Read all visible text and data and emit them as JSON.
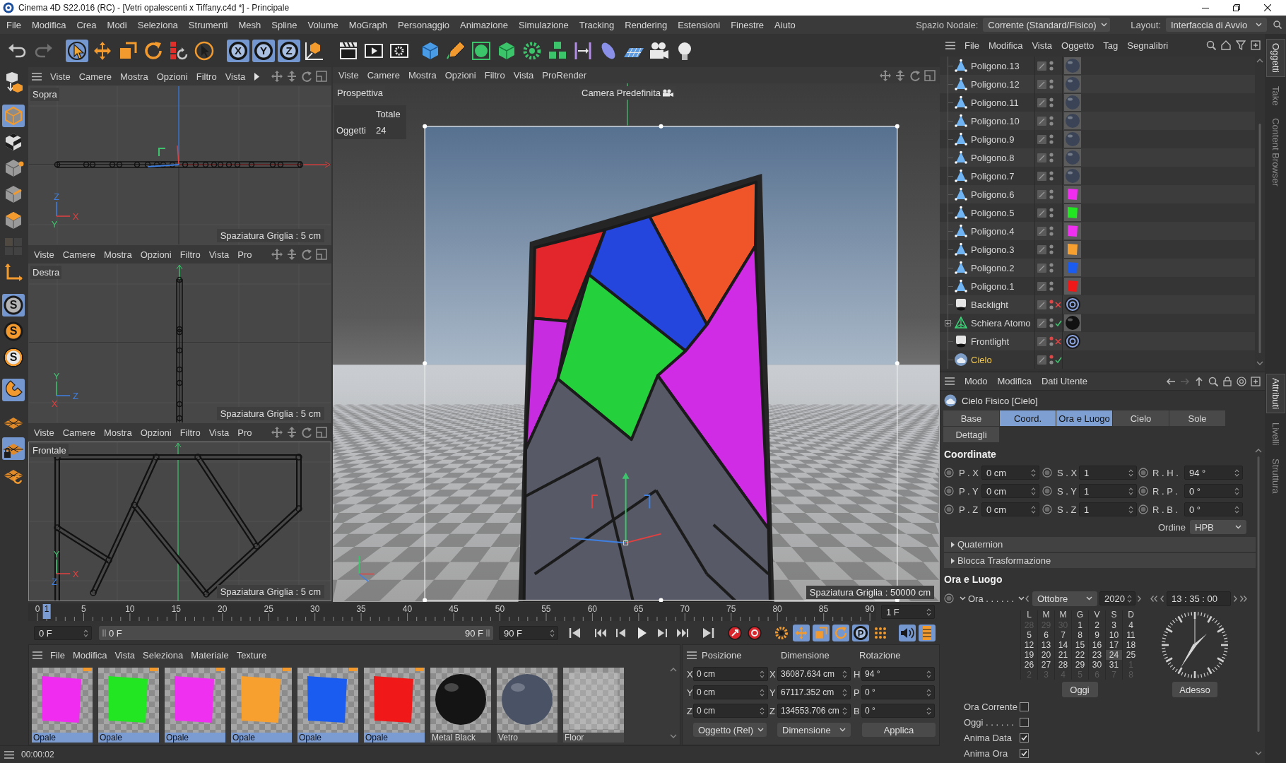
{
  "window": {
    "title": "Cinema 4D S22.016 (RC) - [Vetri opalescenti x Tiffany.c4d *] - Principale"
  },
  "menu_bar": {
    "items": [
      "File",
      "Modifica",
      "Crea",
      "Modi",
      "Seleziona",
      "Strumenti",
      "Mesh",
      "Spline",
      "Volume",
      "MoGraph",
      "Personaggio",
      "Animazione",
      "Simulazione",
      "Tracking",
      "Rendering",
      "Estensioni",
      "Finestre",
      "Aiuto"
    ],
    "node_space": {
      "label": "Spazio Nodale:",
      "value": "Corrente (Standard/Fisico)"
    },
    "layout": {
      "label": "Layout:",
      "value": "Interfaccia di Avvio"
    }
  },
  "toolbar": {
    "tools": [
      {
        "active": false,
        "disabled": false
      },
      {
        "active": false,
        "disabled": true
      },
      {
        "active": true,
        "disabled": false
      },
      {
        "active": false,
        "disabled": false
      },
      {
        "active": false,
        "disabled": false
      },
      {
        "active": false,
        "disabled": false
      },
      {
        "active": false,
        "disabled": false
      },
      {
        "active": false,
        "disabled": false
      },
      {
        "label": "X",
        "active": true,
        "disabled": false
      },
      {
        "label": "Y",
        "active": true,
        "disabled": false
      },
      {
        "label": "Z",
        "active": true,
        "disabled": false
      },
      {
        "active": false,
        "disabled": false
      },
      {
        "active": false,
        "disabled": false
      },
      {
        "active": false,
        "disabled": false
      },
      {
        "active": false,
        "disabled": false
      },
      {
        "active": false,
        "disabled": false
      },
      {
        "active": false,
        "disabled": false
      },
      {
        "active": false,
        "disabled": false
      },
      {
        "active": false,
        "disabled": false
      },
      {
        "active": false,
        "disabled": false
      },
      {
        "active": false,
        "disabled": false
      },
      {
        "active": false,
        "disabled": false
      },
      {
        "active": false,
        "disabled": false
      },
      {
        "active": false,
        "disabled": false
      },
      {
        "active": false,
        "disabled": false
      },
      {
        "active": false,
        "disabled": false
      }
    ]
  },
  "tool_palette": {
    "tools": [
      {
        "active": false,
        "disabled": false
      },
      {
        "active": true,
        "disabled": false
      },
      {
        "active": false,
        "disabled": false
      },
      {
        "active": false,
        "disabled": false
      },
      {
        "active": false,
        "disabled": false
      },
      {
        "active": false,
        "disabled": false
      },
      {
        "active": false,
        "disabled": true
      },
      {
        "active": false,
        "disabled": false
      },
      {
        "label": "S",
        "active": true,
        "disabled": false
      },
      {
        "label": "S",
        "active": false,
        "disabled": false
      },
      {
        "label": "S",
        "active": false,
        "disabled": false
      },
      {
        "active": true,
        "disabled": false
      },
      {
        "active": false,
        "disabled": false
      },
      {
        "active": true,
        "disabled": false
      },
      {
        "active": false,
        "disabled": false
      }
    ]
  },
  "side_viewports": [
    {
      "kind": "top",
      "active": false,
      "panel_menu": true,
      "overflow": true,
      "menu": [
        "Viste",
        "Camere",
        "Mostra",
        "Opzioni",
        "Filtro",
        "Vista"
      ],
      "name": "Sopra",
      "axes": [
        {
          "label": "Z",
          "color": "#3f7fe0"
        },
        {
          "label": "Y",
          "color": "#3ec46d"
        },
        {
          "label": "X",
          "color": "#e04040"
        }
      ],
      "grid_spacing": "Spaziatura Griglia : 5 cm"
    },
    {
      "kind": "right",
      "active": false,
      "panel_menu": false,
      "overflow": false,
      "menu": [
        "Viste",
        "Camere",
        "Mostra",
        "Opzioni",
        "Filtro",
        "Vista",
        "Pro"
      ],
      "name": "Destra",
      "axes": [
        {
          "label": "Y",
          "color": "#3ec46d"
        },
        {
          "label": "X",
          "color": "#e04040"
        },
        {
          "label": "Z",
          "color": "#3f7fe0"
        }
      ],
      "grid_spacing": "Spaziatura Griglia : 5 cm"
    },
    {
      "kind": "front",
      "active": true,
      "panel_menu": false,
      "overflow": false,
      "menu": [
        "Viste",
        "Camere",
        "Mostra",
        "Opzioni",
        "Filtro",
        "Vista",
        "Pro"
      ],
      "name": "Frontale",
      "axes": [
        {
          "label": "Y",
          "color": "#3ec46d"
        },
        {
          "label": "Z",
          "color": "#3f7fe0"
        },
        {
          "label": "X",
          "color": "#e04040"
        }
      ],
      "grid_spacing": "Spaziatura Griglia : 5 cm"
    }
  ],
  "main_viewport": {
    "menu": [
      "Viste",
      "Camere",
      "Mostra",
      "Opzioni",
      "Filtro",
      "Vista",
      "ProRender"
    ],
    "name": "Prospettiva",
    "camera": "Camera Predefinita",
    "hud": {
      "header": "Totale",
      "rows": [
        {
          "label": "Oggetti",
          "value": "24"
        }
      ]
    },
    "grid_spacing": "Spaziatura Griglia : 50000 cm"
  },
  "timeline": {
    "ticks": [
      "0",
      "5",
      "10",
      "15",
      "20",
      "25",
      "30",
      "35",
      "40",
      "45",
      "50",
      "55",
      "60",
      "65",
      "70",
      "75",
      "80",
      "85",
      "90"
    ],
    "playhead": {
      "label": "1",
      "level": 0.0111
    },
    "frame_field": "1 F",
    "start_field": "0 F",
    "range": {
      "start": "0 F",
      "end": "90 F",
      "level": 1
    },
    "end_field": "90 F",
    "key_tools": [
      {
        "active": false
      },
      {
        "active": false
      },
      {
        "active": false
      },
      {
        "active": true
      },
      {
        "active": true
      },
      {
        "active": true
      },
      {
        "label": "P",
        "active": true
      },
      {
        "active": false
      },
      {
        "active": true
      },
      {
        "active": true
      }
    ]
  },
  "materials": {
    "menu": [
      "File",
      "Modifica",
      "Vista",
      "Seleziona",
      "Materiale",
      "Texture"
    ],
    "items": [
      {
        "name": "Opale",
        "kind": "plane",
        "color": "#f02cf0",
        "selected": true,
        "flagged": true
      },
      {
        "name": "Opale",
        "kind": "plane",
        "color": "#22e622",
        "selected": true,
        "flagged": true
      },
      {
        "name": "Opale",
        "kind": "plane",
        "color": "#f030f0",
        "selected": true,
        "flagged": true
      },
      {
        "name": "Opale",
        "kind": "plane",
        "color": "#f7a030",
        "selected": true,
        "flagged": true
      },
      {
        "name": "Opale",
        "kind": "plane",
        "color": "#1a5cf0",
        "selected": true,
        "flagged": true
      },
      {
        "name": "Opale",
        "kind": "plane",
        "color": "#f01818",
        "selected": true,
        "flagged": true
      },
      {
        "name": "Metal Black",
        "kind": "sphere",
        "color": "#141414",
        "selected": false,
        "flagged": false
      },
      {
        "name": "Vetro",
        "kind": "sphere",
        "color": "#4a5366",
        "selected": false,
        "flagged": false
      },
      {
        "name": "Floor",
        "kind": "floor",
        "selected": false,
        "flagged": false
      }
    ]
  },
  "coordinates": {
    "headers": [
      "Posizione",
      "Dimensione",
      "Rotazione"
    ],
    "rows": [
      [
        {
          "axis": "X",
          "value": "0 cm"
        },
        {
          "axis": "X",
          "value": "36087.634 cm"
        },
        {
          "axis": "H",
          "value": "94 °"
        }
      ],
      [
        {
          "axis": "Y",
          "value": "0 cm"
        },
        {
          "axis": "Y",
          "value": "67117.352 cm"
        },
        {
          "axis": "P",
          "value": "0 °"
        }
      ],
      [
        {
          "axis": "Z",
          "value": "0 cm"
        },
        {
          "axis": "Z",
          "value": "134553.706 cm"
        },
        {
          "axis": "B",
          "value": "0 °"
        }
      ]
    ],
    "mode": "Oggetto (Rel)",
    "size_mode": "Dimensione",
    "apply": "Applica"
  },
  "status_bar": {
    "text": "00:00:02"
  },
  "object_manager": {
    "menu": [
      "File",
      "Modifica",
      "Vista",
      "Oggetto",
      "Tag",
      "Segnalibri"
    ],
    "objects": [
      {
        "name": "Poligono.13",
        "kind": "polygon",
        "selected": false,
        "expandable": false,
        "editor_hidden": false,
        "tag": {
          "kind": "sphere",
          "color": "#3a4456"
        }
      },
      {
        "name": "Poligono.12",
        "kind": "polygon",
        "selected": false,
        "expandable": false,
        "editor_hidden": false,
        "tag": {
          "kind": "sphere",
          "color": "#3a4456"
        }
      },
      {
        "name": "Poligono.11",
        "kind": "polygon",
        "selected": false,
        "expandable": false,
        "editor_hidden": false,
        "tag": {
          "kind": "sphere",
          "color": "#3a4456"
        }
      },
      {
        "name": "Poligono.10",
        "kind": "polygon",
        "selected": false,
        "expandable": false,
        "editor_hidden": false,
        "tag": {
          "kind": "sphere",
          "color": "#3a4456"
        }
      },
      {
        "name": "Poligono.9",
        "kind": "polygon",
        "selected": false,
        "expandable": false,
        "editor_hidden": false,
        "tag": {
          "kind": "sphere",
          "color": "#3a4456"
        }
      },
      {
        "name": "Poligono.8",
        "kind": "polygon",
        "selected": false,
        "expandable": false,
        "editor_hidden": false,
        "tag": {
          "kind": "sphere",
          "color": "#3a4456"
        }
      },
      {
        "name": "Poligono.7",
        "kind": "polygon",
        "selected": false,
        "expandable": false,
        "editor_hidden": false,
        "tag": {
          "kind": "sphere",
          "color": "#3a4456"
        }
      },
      {
        "name": "Poligono.6",
        "kind": "polygon",
        "selected": false,
        "expandable": false,
        "editor_hidden": false,
        "tag": {
          "kind": "plane",
          "color": "#f02cf0"
        }
      },
      {
        "name": "Poligono.5",
        "kind": "polygon",
        "selected": false,
        "expandable": false,
        "editor_hidden": false,
        "tag": {
          "kind": "plane",
          "color": "#22e622"
        }
      },
      {
        "name": "Poligono.4",
        "kind": "polygon",
        "selected": false,
        "expandable": false,
        "editor_hidden": false,
        "tag": {
          "kind": "plane",
          "color": "#f030f0"
        }
      },
      {
        "name": "Poligono.3",
        "kind": "polygon",
        "selected": false,
        "expandable": false,
        "editor_hidden": false,
        "tag": {
          "kind": "plane",
          "color": "#f7a030"
        }
      },
      {
        "name": "Poligono.2",
        "kind": "polygon",
        "selected": false,
        "expandable": false,
        "editor_hidden": false,
        "tag": {
          "kind": "plane",
          "color": "#1a5cf0"
        }
      },
      {
        "name": "Poligono.1",
        "kind": "polygon",
        "selected": false,
        "expandable": false,
        "editor_hidden": false,
        "tag": {
          "kind": "plane",
          "color": "#f01818"
        }
      },
      {
        "name": "Backlight",
        "kind": "light",
        "selected": false,
        "expandable": false,
        "editor_hidden": true,
        "enabled": false,
        "tag": {
          "kind": "target"
        }
      },
      {
        "name": "Schiera Atomo",
        "kind": "array",
        "selected": false,
        "expandable": true,
        "editor_hidden": false,
        "enabled": true,
        "tag": {
          "kind": "sphere",
          "color": "#111111"
        }
      },
      {
        "name": "Frontlight",
        "kind": "light",
        "selected": false,
        "expandable": false,
        "editor_hidden": true,
        "enabled": false,
        "tag": {
          "kind": "target"
        }
      },
      {
        "name": "Cielo",
        "kind": "sky",
        "selected": true,
        "expandable": false,
        "editor_hidden": true,
        "enabled": true
      }
    ]
  },
  "side_tabs_top": [
    {
      "label": "Oggetti",
      "selected": true
    },
    {
      "label": "Take",
      "selected": false
    },
    {
      "label": "Content Browser",
      "selected": false
    }
  ],
  "attributes": {
    "menu": [
      "Modo",
      "Modifica",
      "Dati Utente"
    ],
    "title": "Cielo Fisico [Cielo]",
    "tabs": [
      {
        "label": "Base",
        "selected": false
      },
      {
        "label": "Coord.",
        "selected": true
      },
      {
        "label": "Ora e Luogo",
        "selected": true
      },
      {
        "label": "Cielo",
        "selected": false
      },
      {
        "label": "Sole",
        "selected": false
      },
      {
        "label": "Dettagli",
        "selected": false
      }
    ],
    "coord_title": "Coordinate",
    "coord_rows": [
      [
        {
          "label": "P . X",
          "value": "0 cm"
        },
        {
          "label": "S . X",
          "value": "1"
        },
        {
          "label": "R . H .",
          "value": "94 °"
        }
      ],
      [
        {
          "label": "P . Y",
          "value": "0 cm"
        },
        {
          "label": "S . Y",
          "value": "1"
        },
        {
          "label": "R . P .",
          "value": "0 °"
        }
      ],
      [
        {
          "label": "P . Z",
          "value": "0 cm"
        },
        {
          "label": "S . Z",
          "value": "1"
        },
        {
          "label": "R . B .",
          "value": "0 °"
        }
      ]
    ],
    "order": {
      "label": "Ordine",
      "value": "HPB"
    },
    "sections": [
      {
        "label": "Quaternion",
        "expanded": false
      },
      {
        "label": "Blocca Trasformazione",
        "expanded": false
      }
    ],
    "time_title": "Ora e Luogo",
    "time_label": "Ora . . . . . .",
    "month": "Ottobre",
    "year": "2020",
    "time": "13 : 35 : 00",
    "weekdays": [
      "L",
      "M",
      "M",
      "G",
      "V",
      "S",
      "D"
    ],
    "days": [
      {
        "label": "28",
        "in_month": false,
        "selected": false
      },
      {
        "label": "29",
        "in_month": false,
        "selected": false
      },
      {
        "label": "30",
        "in_month": false,
        "selected": false
      },
      {
        "label": "1",
        "in_month": true,
        "selected": false
      },
      {
        "label": "2",
        "in_month": true,
        "selected": false
      },
      {
        "label": "3",
        "in_month": true,
        "selected": false
      },
      {
        "label": "4",
        "in_month": true,
        "selected": false
      },
      {
        "label": "5",
        "in_month": true,
        "selected": false
      },
      {
        "label": "6",
        "in_month": true,
        "selected": false
      },
      {
        "label": "7",
        "in_month": true,
        "selected": false
      },
      {
        "label": "8",
        "in_month": true,
        "selected": false
      },
      {
        "label": "9",
        "in_month": true,
        "selected": false
      },
      {
        "label": "10",
        "in_month": true,
        "selected": false
      },
      {
        "label": "11",
        "in_month": true,
        "selected": false
      },
      {
        "label": "12",
        "in_month": true,
        "selected": false
      },
      {
        "label": "13",
        "in_month": true,
        "selected": false
      },
      {
        "label": "14",
        "in_month": true,
        "selected": false
      },
      {
        "label": "15",
        "in_month": true,
        "selected": false
      },
      {
        "label": "16",
        "in_month": true,
        "selected": false
      },
      {
        "label": "17",
        "in_month": true,
        "selected": false
      },
      {
        "label": "18",
        "in_month": true,
        "selected": false
      },
      {
        "label": "19",
        "in_month": true,
        "selected": false
      },
      {
        "label": "20",
        "in_month": true,
        "selected": false
      },
      {
        "label": "21",
        "in_month": true,
        "selected": false
      },
      {
        "label": "22",
        "in_month": true,
        "selected": false
      },
      {
        "label": "23",
        "in_month": true,
        "selected": false
      },
      {
        "label": "24",
        "in_month": true,
        "selected": true
      },
      {
        "label": "25",
        "in_month": true,
        "selected": false
      },
      {
        "label": "26",
        "in_month": true,
        "selected": false
      },
      {
        "label": "27",
        "in_month": true,
        "selected": false
      },
      {
        "label": "28",
        "in_month": true,
        "selected": false
      },
      {
        "label": "29",
        "in_month": true,
        "selected": false
      },
      {
        "label": "30",
        "in_month": true,
        "selected": false
      },
      {
        "label": "31",
        "in_month": true,
        "selected": false
      },
      {
        "label": "1",
        "in_month": false,
        "selected": false
      },
      {
        "label": "2",
        "in_month": false,
        "selected": false
      },
      {
        "label": "3",
        "in_month": false,
        "selected": false
      },
      {
        "label": "4",
        "in_month": false,
        "selected": false
      },
      {
        "label": "5",
        "in_month": false,
        "selected": false
      },
      {
        "label": "6",
        "in_month": false,
        "selected": false
      },
      {
        "label": "7",
        "in_month": false,
        "selected": false
      },
      {
        "label": "8",
        "in_month": false,
        "selected": false
      }
    ],
    "today_button": "Oggi",
    "now_button": "Adesso",
    "options": [
      {
        "label": "Ora Corrente",
        "checked": false
      },
      {
        "label": "Oggi . . . . . .",
        "checked": false
      },
      {
        "label": "Anima Data",
        "checked": true
      },
      {
        "label": "Anima Ora",
        "checked": true
      }
    ]
  },
  "side_tabs_bottom": [
    {
      "label": "Attributi",
      "selected": true
    },
    {
      "label": "Livelli",
      "selected": false
    },
    {
      "label": "Struttura",
      "selected": false
    }
  ]
}
